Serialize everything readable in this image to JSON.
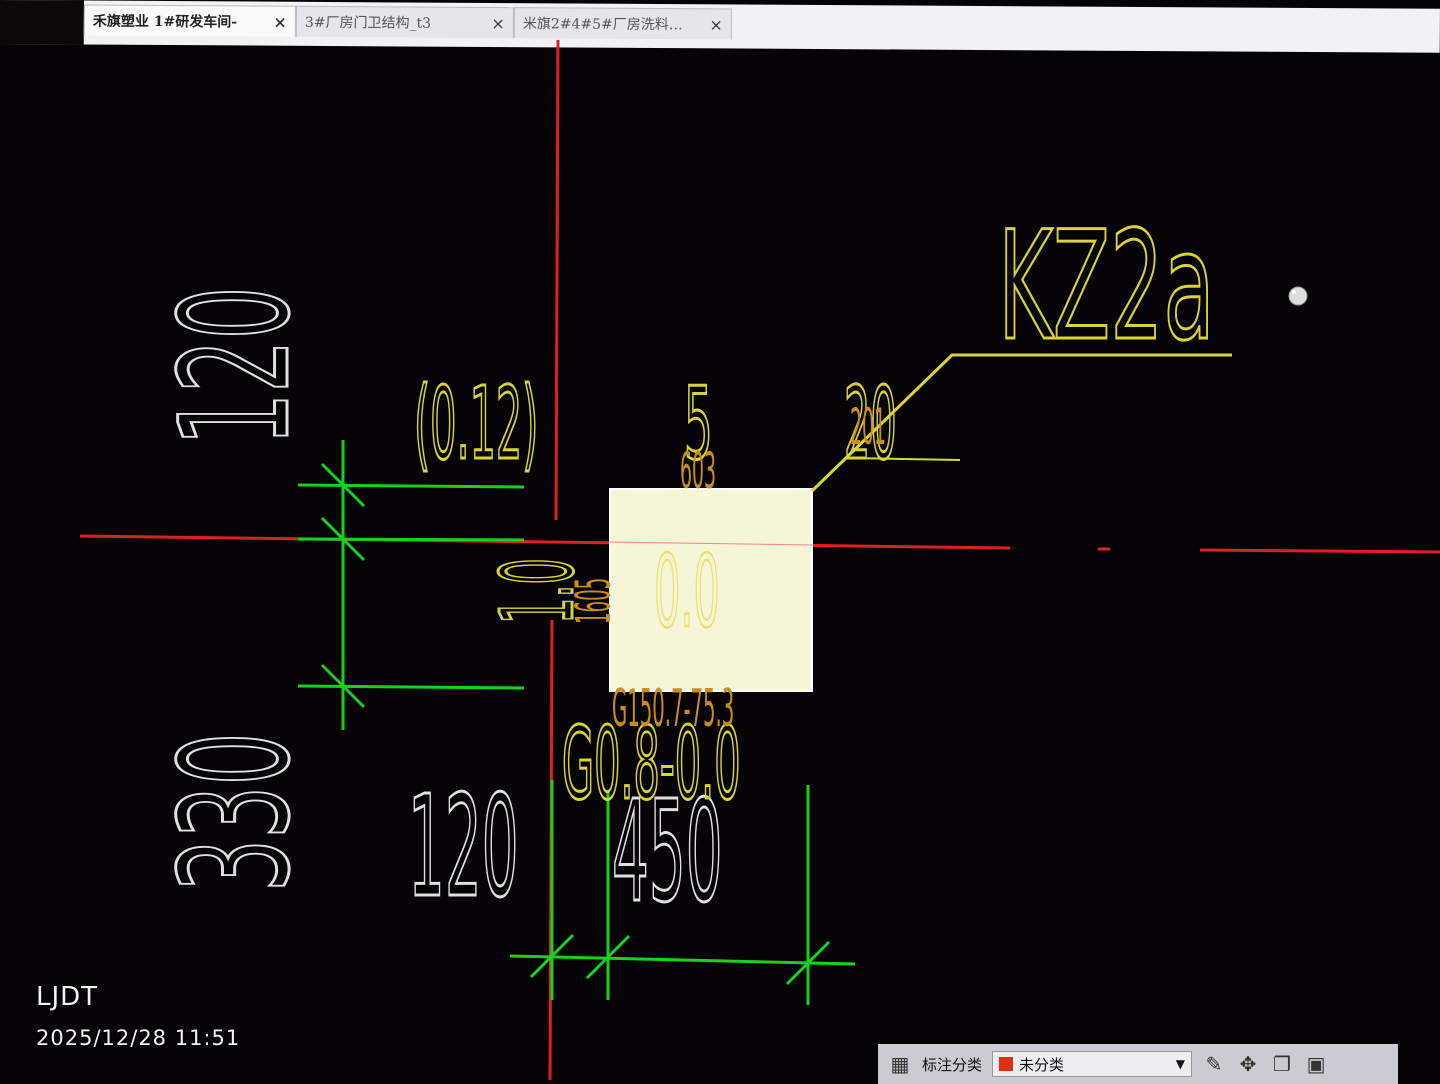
{
  "tabs": [
    {
      "label": "禾旗塑业 1#研发车间-",
      "close": "×",
      "active": true
    },
    {
      "label": "3#厂房门卫结构_t3",
      "close": "×",
      "active": false
    },
    {
      "label": "米旗2#4#5#厂房洗料…",
      "close": "×",
      "active": false
    }
  ],
  "drawing": {
    "column_id": "KZ2a",
    "top_dimension": "120",
    "lower_dimension": "330",
    "area_ratio": "(0.12)",
    "top_value_5": "5",
    "top_value_20": "20",
    "small_201": "201",
    "small_60": "603",
    "center_value": "0.0",
    "left_value": "1.0",
    "left_small": "1605",
    "small_g": "G150.7-75.3",
    "g_label": "G0.8-0.0",
    "bottom_dim_120": "120",
    "bottom_dim_450": "450",
    "colors": {
      "yellow": "#d8d437",
      "orange": "#c88f1e",
      "green": "#16d21e",
      "red": "#e02020",
      "white": "#e8e8e8"
    }
  },
  "watermark": {
    "name": "LJDT",
    "timestamp": "2025/12/28 11:51"
  },
  "toolbar": {
    "grid_icon": "grid-icon",
    "annotation_label": "标注分类",
    "category_value": "未分类",
    "category_color": "#e03010",
    "dropdown_arrow": "▼",
    "edit_icon": "edit-icon",
    "move_icon": "move-icon",
    "copy_icon": "copy-icon",
    "paste_icon": "paste-icon"
  }
}
